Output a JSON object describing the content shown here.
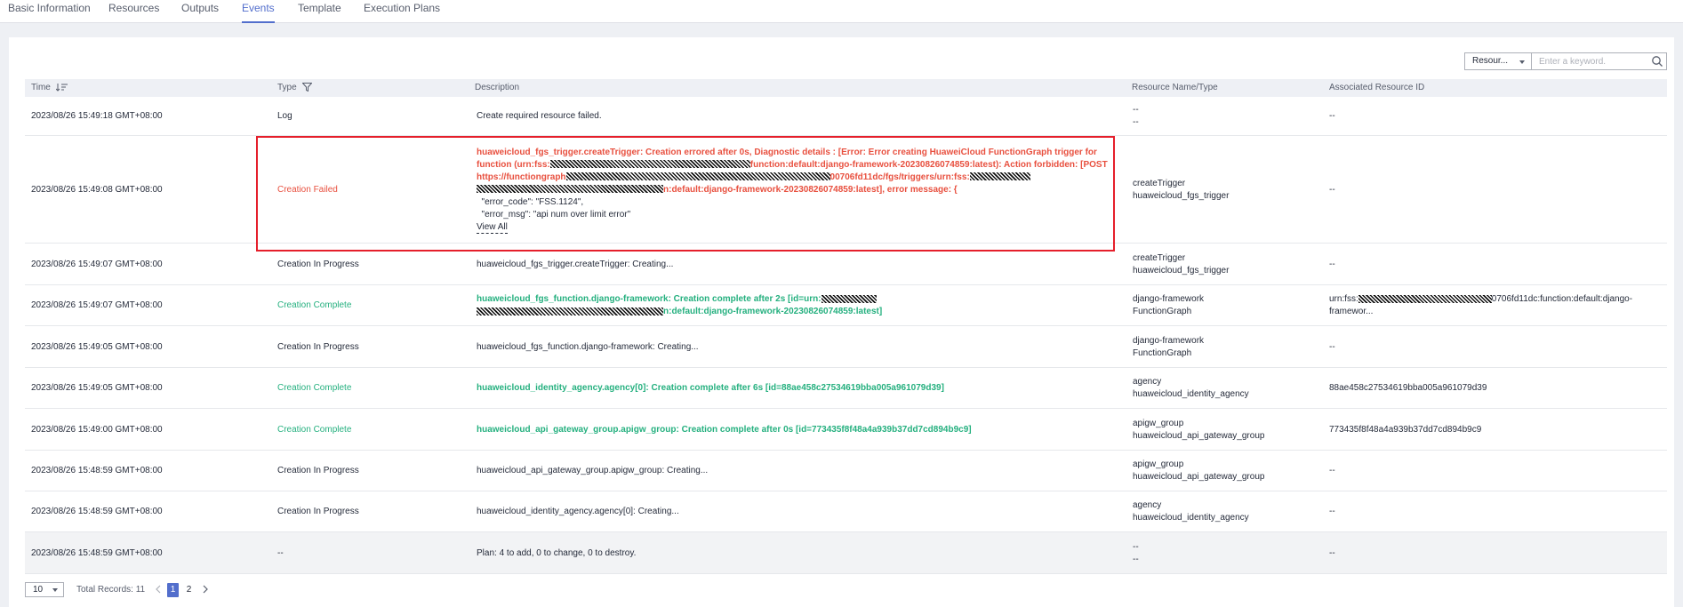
{
  "tabs": [
    "Basic Information",
    "Resources",
    "Outputs",
    "Events",
    "Template",
    "Execution Plans"
  ],
  "search": {
    "resource_select": "Resour...",
    "keyword_placeholder": "Enter a keyword."
  },
  "columns": {
    "time": "Time",
    "type": "Type",
    "description": "Description",
    "resource": "Resource Name/Type",
    "assoc": "Associated Resource ID"
  },
  "rows": [
    {
      "time": "2023/08/26 15:49:18 GMT+08:00",
      "type": "Log",
      "description": "Create required resource failed.",
      "res_name": "--",
      "res_type": "--",
      "assoc": "--"
    },
    {
      "time": "2023/08/26 15:49:08 GMT+08:00",
      "type": "Creation Failed",
      "desc_line1": "huaweicloud_fgs_trigger.createTrigger: Creation errored after 0s, Diagnostic details : [Error: Error creating HuaweiCloud FunctionGraph trigger for",
      "desc_line2a": "function (urn:fss:",
      "desc_line2b": "function:default:django-framework-20230826074859:latest): Action forbidden: [POST",
      "desc_line3a": "https://functiongraph",
      "desc_line3b": "00706fd11dc/fgs/triggers/urn:fss:",
      "desc_line4b": "n:default:django-framework-20230826074859:latest], error message: {",
      "desc_line5": "  \"error_code\": \"FSS.1124\",",
      "desc_line6": "  \"error_msg\": \"api num over limit error\"",
      "view_all": "View All",
      "res_name": "createTrigger",
      "res_type": "huaweicloud_fgs_trigger",
      "assoc": "--"
    },
    {
      "time": "2023/08/26 15:49:07 GMT+08:00",
      "type": "Creation In Progress",
      "description": "huaweicloud_fgs_trigger.createTrigger: Creating...",
      "res_name": "createTrigger",
      "res_type": "huaweicloud_fgs_trigger",
      "assoc": "--"
    },
    {
      "time": "2023/08/26 15:49:07 GMT+08:00",
      "type": "Creation Complete",
      "desc_line1": "huaweicloud_fgs_function.django-framework: Creation complete after 2s [id=urn:",
      "desc_line2b": "n:default:django-framework-20230826074859:latest]",
      "res_name": "django-framework",
      "res_type": "FunctionGraph",
      "assoc_a": "urn:fss:",
      "assoc_b": "0706fd11dc:function:default:django-framewor..."
    },
    {
      "time": "2023/08/26 15:49:05 GMT+08:00",
      "type": "Creation In Progress",
      "description": "huaweicloud_fgs_function.django-framework: Creating...",
      "res_name": "django-framework",
      "res_type": "FunctionGraph",
      "assoc": "--"
    },
    {
      "time": "2023/08/26 15:49:05 GMT+08:00",
      "type": "Creation Complete",
      "description": "huaweicloud_identity_agency.agency[0]: Creation complete after 6s [id=88ae458c27534619bba005a961079d39]",
      "res_name": "agency",
      "res_type": "huaweicloud_identity_agency",
      "assoc": "88ae458c27534619bba005a961079d39"
    },
    {
      "time": "2023/08/26 15:49:00 GMT+08:00",
      "type": "Creation Complete",
      "description": "huaweicloud_api_gateway_group.apigw_group: Creation complete after 0s [id=773435f8f48a4a939b37dd7cd894b9c9]",
      "res_name": "apigw_group",
      "res_type": "huaweicloud_api_gateway_group",
      "assoc": "773435f8f48a4a939b37dd7cd894b9c9"
    },
    {
      "time": "2023/08/26 15:48:59 GMT+08:00",
      "type": "Creation In Progress",
      "description": "huaweicloud_api_gateway_group.apigw_group: Creating...",
      "res_name": "apigw_group",
      "res_type": "huaweicloud_api_gateway_group",
      "assoc": "--"
    },
    {
      "time": "2023/08/26 15:48:59 GMT+08:00",
      "type": "Creation In Progress",
      "description": "huaweicloud_identity_agency.agency[0]: Creating...",
      "res_name": "agency",
      "res_type": "huaweicloud_identity_agency",
      "assoc": "--"
    },
    {
      "time": "2023/08/26 15:48:59 GMT+08:00",
      "type": "--",
      "description": "Plan: 4 to add, 0 to change, 0 to destroy.",
      "res_name": "--",
      "res_type": "--",
      "assoc": "--"
    }
  ],
  "pagination": {
    "page_size": "10",
    "total": "Total Records: 11",
    "pages": [
      "1",
      "2"
    ],
    "current": "1"
  },
  "colors": {
    "accent": "#526ecc",
    "success": "#25b07f",
    "error": "#e8503f",
    "callout": "#e51f2b"
  }
}
